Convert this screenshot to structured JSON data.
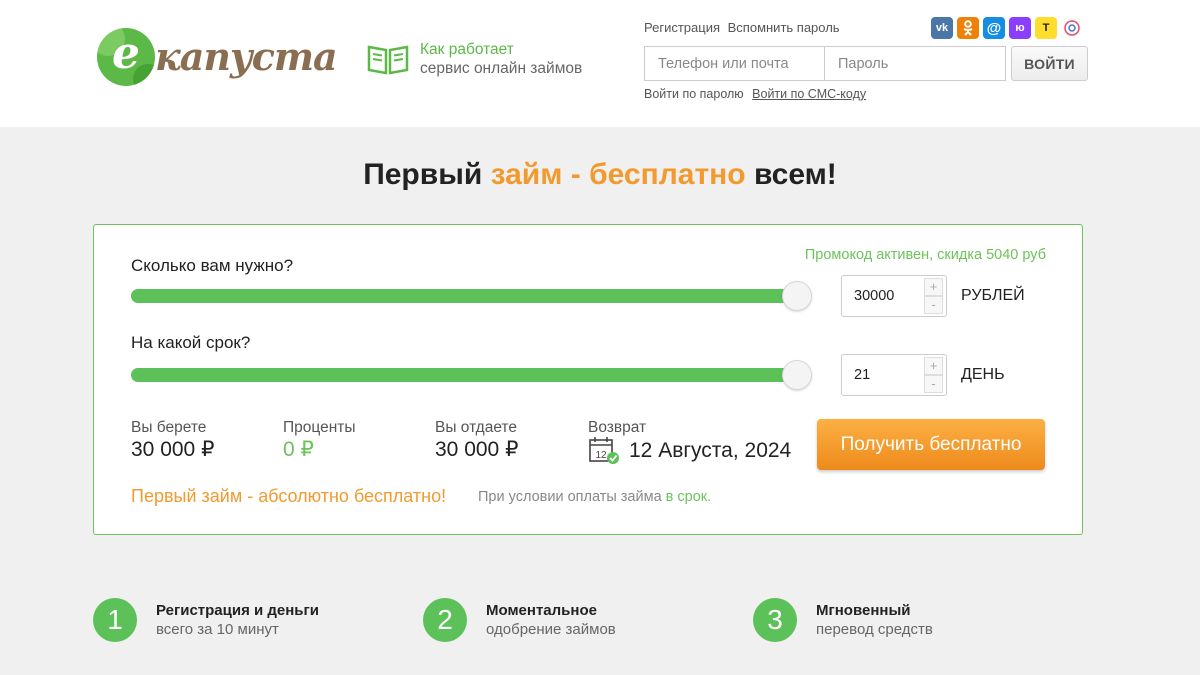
{
  "header": {
    "logo_letter": "e",
    "logo_word": "капуста",
    "how_line1": "Как работает",
    "how_line2": "сервис онлайн займов",
    "link_register": "Регистрация",
    "link_recover": "Вспомнить пароль",
    "social": [
      {
        "name": "vk-icon",
        "glyph": "vk",
        "color": "#4a76a8"
      },
      {
        "name": "odnoklassniki-icon",
        "glyph": "ok",
        "color": "#ee8208"
      },
      {
        "name": "mailru-icon",
        "glyph": "@",
        "color": "#168de2"
      },
      {
        "name": "yoomoney-icon",
        "glyph": "ю",
        "color": "#8b3ffd"
      },
      {
        "name": "tinkoff-icon",
        "glyph": "T",
        "color": "#ffdd2d"
      },
      {
        "name": "sber-icon",
        "glyph": "✿",
        "color": "#ffffff"
      }
    ],
    "phone_placeholder": "Телефон или почта",
    "password_placeholder": "Пароль",
    "login_button": "ВОЙТИ",
    "login_by_password": "Войти по паролю",
    "login_by_sms": "Войти по СМС-коду"
  },
  "headline": {
    "part1": "Первый ",
    "part2": "займ - бесплатно",
    "part3": " всем!"
  },
  "calculator": {
    "promo": "Промокод активен, скидка 5040 руб",
    "amount_question": "Сколько вам нужно?",
    "amount_value": "30000",
    "amount_unit": "РУБЛЕЙ",
    "amount_slider_fraction": 1.0,
    "term_question": "На какой срок?",
    "term_value": "21",
    "term_unit": "ДЕНЬ",
    "term_slider_fraction": 1.0,
    "plus": "+",
    "minus": "-",
    "take_label": "Вы берете",
    "take_value": "30 000 ₽",
    "interest_label": "Проценты",
    "interest_value": "0 ₽",
    "give_label": "Вы отдаете",
    "give_value": "30 000 ₽",
    "return_label": "Возврат",
    "return_value": "12 Августа, 2024",
    "calendar_day": "12",
    "get_button": "Получить бесплатно",
    "note": "Первый займ - абсолютно бесплатно!",
    "condition_text": "При условии оплаты займа ",
    "condition_highlight": "в срок."
  },
  "steps": [
    {
      "num": "1",
      "title": "Регистрация и деньги",
      "sub": "всего за 10 минут"
    },
    {
      "num": "2",
      "title": "Моментальное",
      "sub": "одобрение займов"
    },
    {
      "num": "3",
      "title": "Мгновенный",
      "sub": "перевод средств"
    }
  ]
}
